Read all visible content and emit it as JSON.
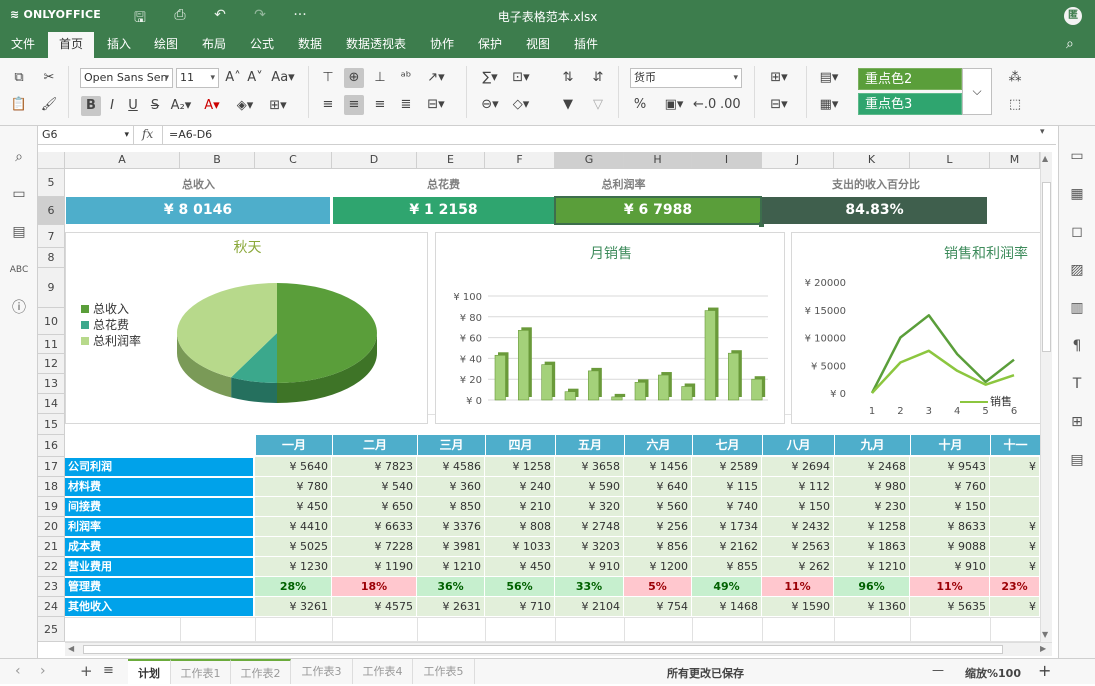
{
  "app": {
    "logo": "ONLYOFFICE",
    "title": "电子表格范本.xlsx",
    "avatar": "匿"
  },
  "menu": [
    "文件",
    "首页",
    "插入",
    "绘图",
    "布局",
    "公式",
    "数据",
    "数据透视表",
    "协作",
    "保护",
    "视图",
    "插件"
  ],
  "toolbar": {
    "font_name": "Open Sans Sen",
    "font_size": "11",
    "number_format": "货币",
    "style1": "重点色2",
    "style2": "重点色3",
    "copy_style_icon": "format-painter-icon"
  },
  "formula": {
    "cell_ref": "G6",
    "fx": "fx",
    "value": "=A6-D6"
  },
  "columns": [
    "A",
    "B",
    "C",
    "D",
    "E",
    "F",
    "G",
    "H",
    "I",
    "J",
    "K",
    "L",
    "M"
  ],
  "rows": [
    "5",
    "6",
    "7",
    "8",
    "9",
    "10",
    "11",
    "12",
    "13",
    "14",
    "15",
    "16",
    "17",
    "18",
    "19",
    "20",
    "21",
    "22",
    "23",
    "24",
    "25"
  ],
  "kpis": [
    {
      "label": "总收入",
      "value": "¥ 8 0146",
      "color": "#4eaecb"
    },
    {
      "label": "总花费",
      "value": "¥ 1 2158",
      "color": "#2fa56f"
    },
    {
      "label": "总利润率",
      "value": "¥ 6 7988",
      "color": "#5a9e3a"
    },
    {
      "label": "支出的收入百分比",
      "value": "84.83%",
      "color": "#3f5f4d"
    }
  ],
  "chart_data": [
    {
      "type": "pie",
      "title": "秋天",
      "legend": [
        "总收入",
        "总花费",
        "总利润率"
      ],
      "values": [
        80146,
        12158,
        67988
      ],
      "colors": [
        "#5a9e3a",
        "#3ba88c",
        "#b7d98b"
      ]
    },
    {
      "type": "bar",
      "title": "月销售",
      "y_ticks": [
        "¥ 100",
        "¥ 80",
        "¥ 60",
        "¥ 40",
        "¥ 20",
        "¥ 0"
      ],
      "ylim": [
        0,
        100
      ],
      "values": [
        43,
        67,
        34,
        8,
        28,
        3,
        17,
        24,
        13,
        86,
        45,
        20
      ]
    },
    {
      "type": "line",
      "title": "销售和利润率",
      "y_ticks": [
        "¥ 20000",
        "¥ 15000",
        "¥ 10000",
        "¥ 5000",
        "¥ 0"
      ],
      "x_ticks": [
        "1",
        "2",
        "3",
        "4",
        "5",
        "6"
      ],
      "ylim": [
        0,
        20000
      ],
      "legend": [
        "销售"
      ],
      "series": [
        {
          "name": "销售",
          "values": [
            0,
            10000,
            14000,
            7000,
            2000,
            6000
          ]
        },
        {
          "name": "",
          "values": [
            0,
            5500,
            7600,
            4000,
            1500,
            3200
          ]
        }
      ]
    }
  ],
  "months": [
    "一月",
    "二月",
    "三月",
    "四月",
    "五月",
    "六月",
    "七月",
    "八月",
    "九月",
    "十月",
    "十一"
  ],
  "table": [
    {
      "label": "公司利润",
      "values": [
        "¥ 5640",
        "¥ 7823",
        "¥ 4586",
        "¥ 1258",
        "¥ 3658",
        "¥ 1456",
        "¥ 2589",
        "¥ 2694",
        "¥ 2468",
        "¥ 9543",
        "¥"
      ]
    },
    {
      "label": "材料费",
      "values": [
        "¥ 780",
        "¥ 540",
        "¥ 360",
        "¥ 240",
        "¥ 590",
        "¥ 640",
        "¥ 115",
        "¥ 112",
        "¥ 980",
        "¥ 760",
        ""
      ]
    },
    {
      "label": "间接费",
      "values": [
        "¥ 450",
        "¥ 650",
        "¥ 850",
        "¥ 210",
        "¥ 320",
        "¥ 560",
        "¥ 740",
        "¥ 150",
        "¥ 230",
        "¥ 150",
        ""
      ]
    },
    {
      "label": "利润率",
      "values": [
        "¥ 4410",
        "¥ 6633",
        "¥ 3376",
        "¥ 808",
        "¥ 2748",
        "¥ 256",
        "¥ 1734",
        "¥ 2432",
        "¥ 1258",
        "¥ 8633",
        "¥"
      ]
    },
    {
      "label": "成本费",
      "values": [
        "¥ 5025",
        "¥ 7228",
        "¥ 3981",
        "¥ 1033",
        "¥ 3203",
        "¥ 856",
        "¥ 2162",
        "¥ 2563",
        "¥ 1863",
        "¥ 9088",
        "¥"
      ]
    },
    {
      "label": "营业费用",
      "values": [
        "¥ 1230",
        "¥ 1190",
        "¥ 1210",
        "¥ 450",
        "¥ 910",
        "¥ 1200",
        "¥ 855",
        "¥ 262",
        "¥ 1210",
        "¥ 910",
        "¥"
      ]
    },
    {
      "label": "管理费",
      "values": [
        "28%",
        "18%",
        "36%",
        "56%",
        "33%",
        "5%",
        "49%",
        "11%",
        "96%",
        "11%",
        "23%"
      ],
      "pct": true,
      "tones": [
        "g",
        "r",
        "g",
        "g",
        "g",
        "r",
        "g",
        "r",
        "g",
        "r",
        "r"
      ]
    },
    {
      "label": "其他收入",
      "values": [
        "¥ 3261",
        "¥ 4575",
        "¥ 2631",
        "¥ 710",
        "¥ 2104",
        "¥ 754",
        "¥ 1468",
        "¥ 1590",
        "¥ 1360",
        "¥ 5635",
        "¥"
      ]
    }
  ],
  "sheets": [
    "计划",
    "工作表1",
    "工作表2",
    "工作表3",
    "工作表4",
    "工作表5"
  ],
  "status": {
    "saved": "所有更改已保存",
    "zoom": "缩放%100",
    "minus": "—",
    "plus": "+"
  }
}
